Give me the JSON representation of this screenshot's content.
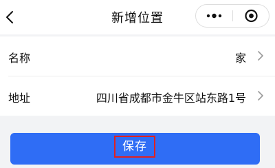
{
  "header": {
    "title": "新增位置",
    "back_icon": "chevron-left-icon",
    "more_icon": "more-dots-icon",
    "close_icon": "target-close-icon"
  },
  "form": {
    "rows": [
      {
        "label": "名称",
        "value": "家"
      },
      {
        "label": "地址",
        "value": "四川省成都市金牛区站东路1号"
      }
    ]
  },
  "actions": {
    "save_label": "保存"
  },
  "colors": {
    "primary": "#2f6df5",
    "highlight": "#e02020",
    "background": "#f2f3f5"
  }
}
